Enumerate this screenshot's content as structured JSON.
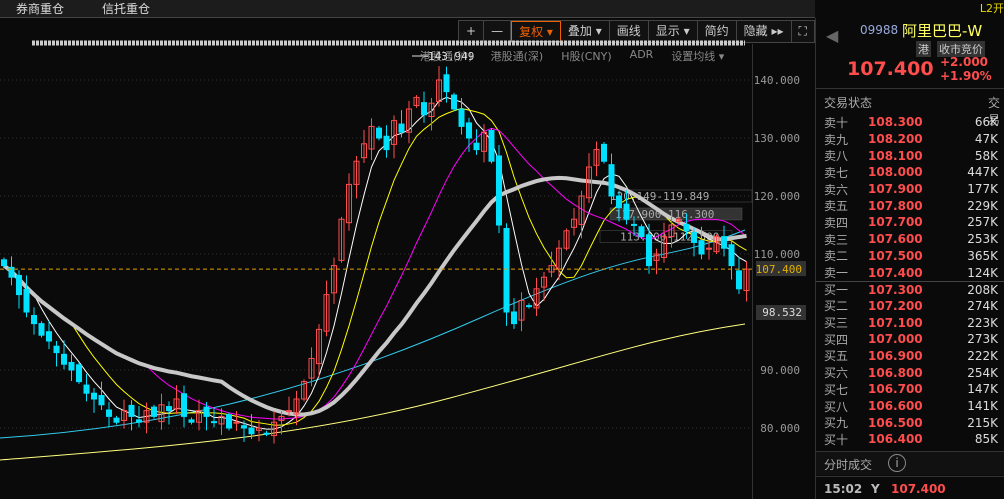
{
  "topbar": {
    "tabs": [
      "券商重仓",
      "信托重仓"
    ],
    "l2": "L2开"
  },
  "toolbar": {
    "zoom_in": "+",
    "zoom_out": "—",
    "adjust": "复权 ▾",
    "overlay": "叠加 ▾",
    "draw": "画线",
    "display": "显示 ▾",
    "simple": "简约",
    "hide": "隐藏 ▸▸",
    "fullscreen": "⛶"
  },
  "subbar": {
    "items": [
      "港股通(沪)",
      "港股通(深)",
      "H股(CNY)",
      "ADR",
      "设置均线 ▾"
    ]
  },
  "stock": {
    "code": "09988",
    "name": "阿里巴巴-W",
    "market": "港",
    "status": "收市竞价",
    "price": "107.400",
    "change": "+2.000",
    "change_pct": "+1.90%"
  },
  "orderbook": {
    "header": "交易状态",
    "header2": "交易",
    "asks": [
      [
        "卖十",
        "108.300",
        "66K"
      ],
      [
        "卖九",
        "108.200",
        "47K"
      ],
      [
        "卖八",
        "108.100",
        "58K"
      ],
      [
        "卖七",
        "108.000",
        "447K"
      ],
      [
        "卖六",
        "107.900",
        "177K"
      ],
      [
        "卖五",
        "107.800",
        "229K"
      ],
      [
        "卖四",
        "107.700",
        "257K"
      ],
      [
        "卖三",
        "107.600",
        "253K"
      ],
      [
        "卖二",
        "107.500",
        "365K"
      ],
      [
        "卖一",
        "107.400",
        "124K"
      ]
    ],
    "bids": [
      [
        "买一",
        "107.300",
        "208K"
      ],
      [
        "买二",
        "107.200",
        "274K"
      ],
      [
        "买三",
        "107.100",
        "223K"
      ],
      [
        "买四",
        "107.000",
        "273K"
      ],
      [
        "买五",
        "106.900",
        "222K"
      ],
      [
        "买六",
        "106.800",
        "254K"
      ],
      [
        "买七",
        "106.700",
        "147K"
      ],
      [
        "买八",
        "106.600",
        "141K"
      ],
      [
        "买九",
        "106.500",
        "215K"
      ],
      [
        "买十",
        "106.400",
        "85K"
      ]
    ]
  },
  "trades": {
    "title": "分时成交",
    "rows": [
      [
        "15:02",
        "Y",
        "107.400"
      ]
    ]
  },
  "chart_data": {
    "type": "candlestick",
    "ylim": [
      78,
      146
    ],
    "yticks": [
      "140.000",
      "130.000",
      "120.000",
      "110.000",
      "90.000",
      "80.000"
    ],
    "last_price_label": "107.400",
    "ref_label": "98.532",
    "high_label": "143.949",
    "zones": [
      "120.149-119.849",
      "117.900-116.300",
      "113.600-112.500"
    ],
    "closes": [
      108,
      106,
      103,
      100,
      98,
      96,
      95,
      93,
      91,
      90,
      88,
      86,
      85,
      84,
      82,
      81,
      83,
      82,
      81,
      83,
      82,
      84,
      83,
      85,
      82,
      81,
      83,
      82,
      81,
      82,
      80,
      81,
      80,
      79,
      80,
      79,
      81,
      82,
      83,
      85,
      88,
      92,
      97,
      103,
      108,
      116,
      122,
      126,
      129,
      132,
      130,
      128,
      133,
      131,
      135,
      137,
      134,
      136,
      140,
      138,
      135,
      132,
      130,
      128,
      131,
      126,
      115,
      100,
      98,
      102,
      101,
      104,
      106,
      108,
      111,
      114,
      116,
      120,
      125,
      128,
      126,
      120,
      118,
      116,
      115,
      113,
      108,
      110,
      113,
      115,
      116,
      114,
      112,
      110,
      111,
      113,
      111,
      108,
      104,
      107.4
    ],
    "ma_windows": [
      5,
      10,
      20,
      30
    ],
    "colors": {
      "up": "#ff4d4d",
      "down": "#00e0ff",
      "ma5": "#ffffff",
      "ma10": "#ffff00",
      "ma20": "#ff00ff",
      "ma30": "#c8c8c8"
    }
  }
}
